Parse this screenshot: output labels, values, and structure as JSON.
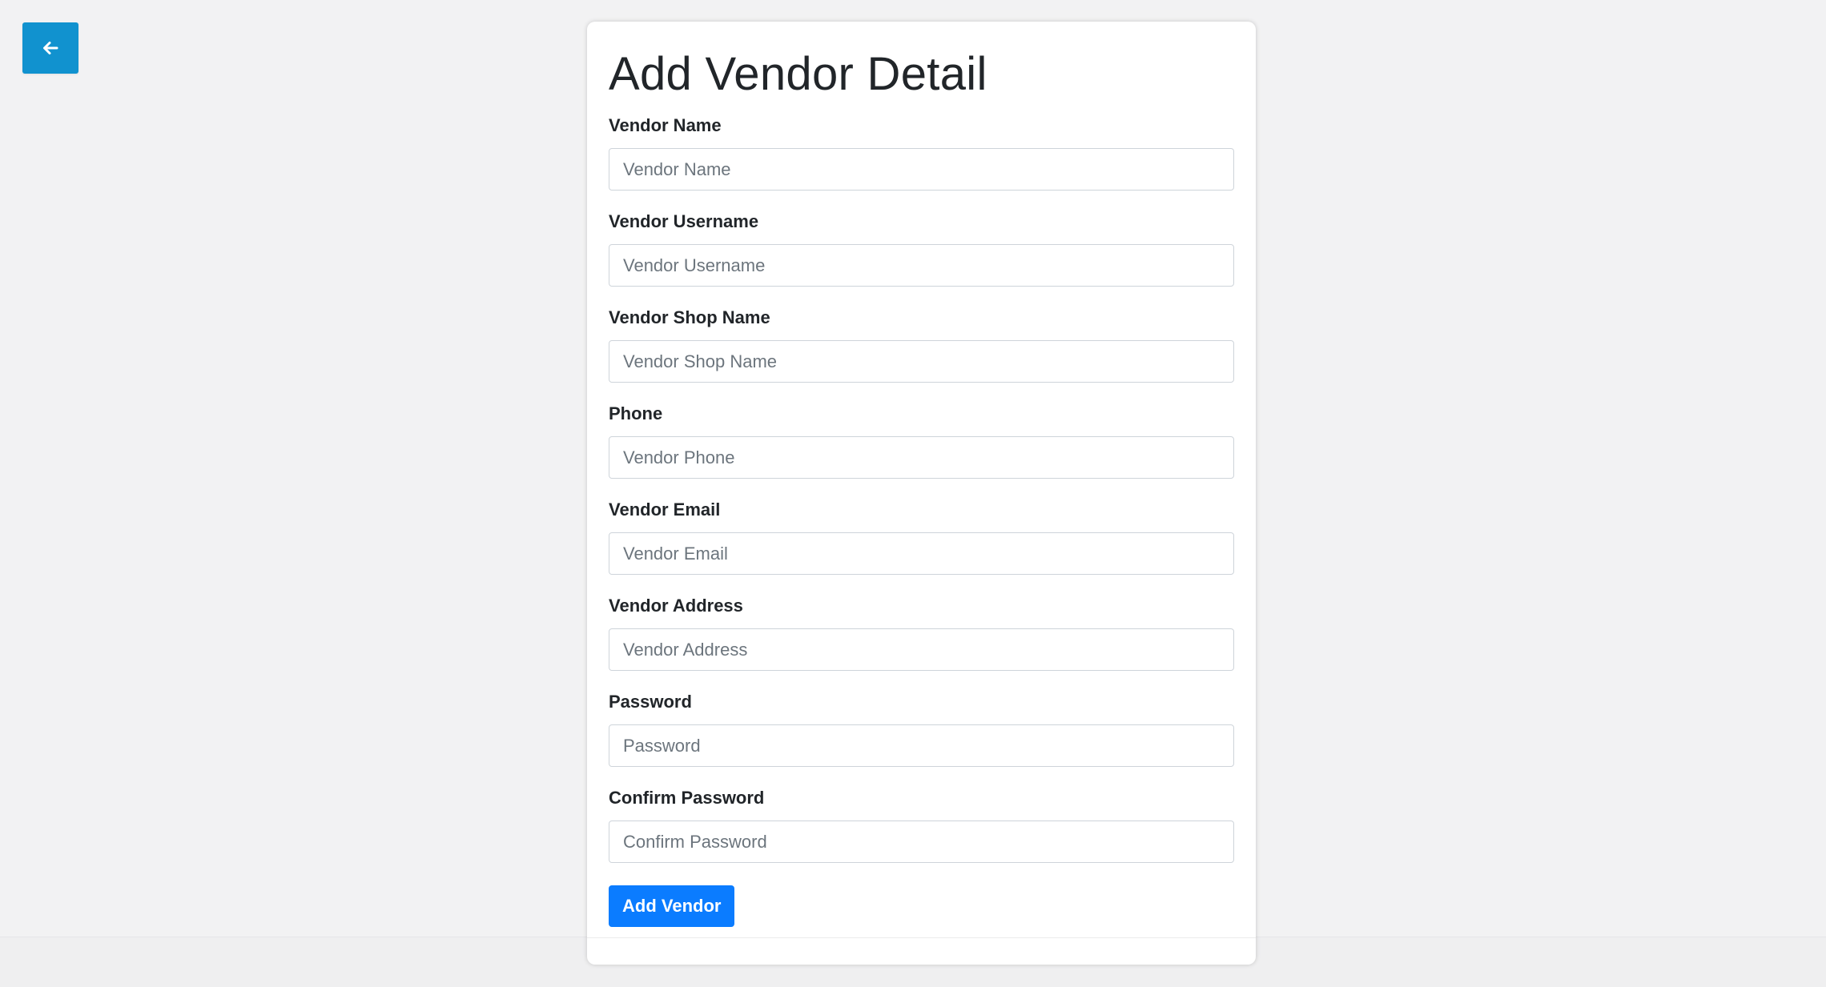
{
  "navigation": {
    "back_icon": "arrow-left-icon",
    "back_color": "#1192cf"
  },
  "form": {
    "title": "Add Vendor Detail",
    "fields": [
      {
        "label": "Vendor Name",
        "placeholder": "Vendor Name",
        "value": ""
      },
      {
        "label": "Vendor Username",
        "placeholder": "Vendor Username",
        "value": ""
      },
      {
        "label": "Vendor Shop Name",
        "placeholder": "Vendor Shop Name",
        "value": ""
      },
      {
        "label": "Phone",
        "placeholder": "Vendor Phone",
        "value": ""
      },
      {
        "label": "Vendor Email",
        "placeholder": "Vendor Email",
        "value": ""
      },
      {
        "label": "Vendor Address",
        "placeholder": "Vendor Address",
        "value": ""
      },
      {
        "label": "Password",
        "placeholder": "Password",
        "value": ""
      },
      {
        "label": "Confirm Password",
        "placeholder": "Confirm Password",
        "value": ""
      }
    ],
    "submit_label": "Add Vendor",
    "submit_color": "#0b7cff"
  }
}
